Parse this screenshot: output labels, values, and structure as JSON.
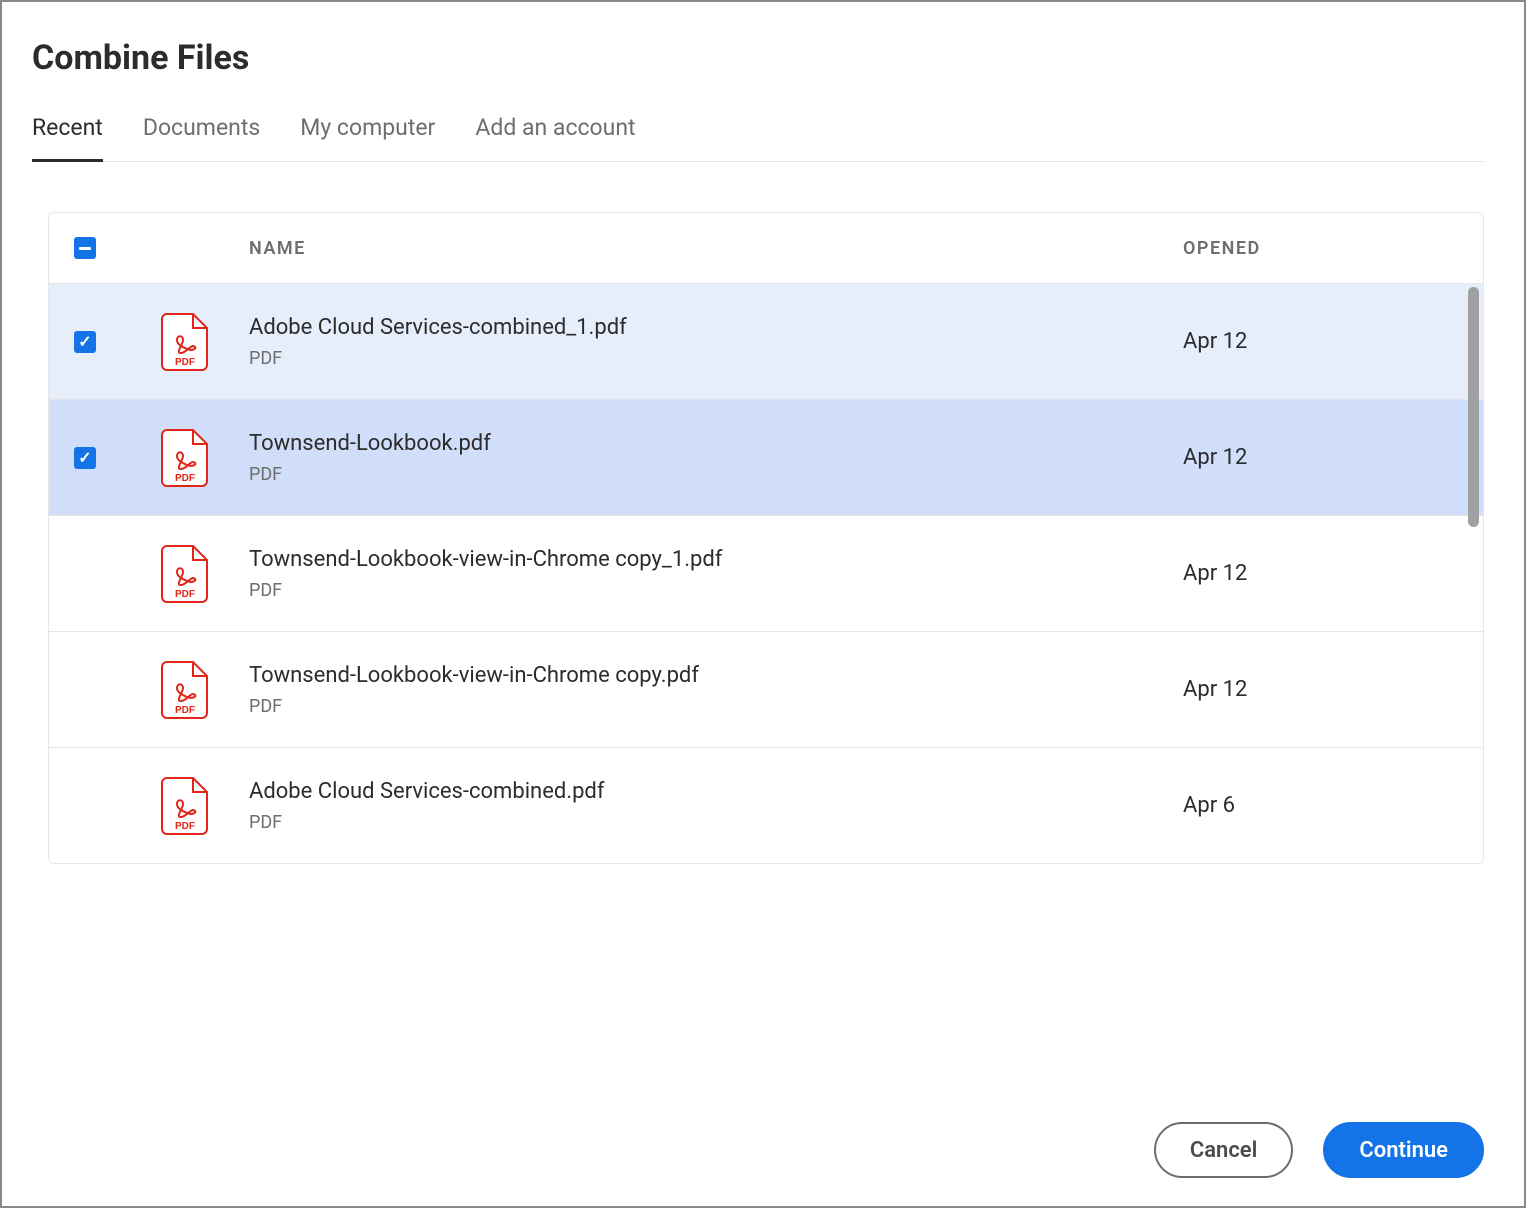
{
  "title": "Combine Files",
  "tabs": [
    {
      "label": "Recent",
      "active": true
    },
    {
      "label": "Documents",
      "active": false
    },
    {
      "label": "My computer",
      "active": false
    },
    {
      "label": "Add an account",
      "active": false
    }
  ],
  "headers": {
    "name": "NAME",
    "opened": "OPENED"
  },
  "files": [
    {
      "name": "Adobe Cloud Services-combined_1.pdf",
      "type": "PDF",
      "opened": "Apr 12",
      "selected": true,
      "hover": false
    },
    {
      "name": "Townsend-Lookbook.pdf",
      "type": "PDF",
      "opened": "Apr 12",
      "selected": true,
      "hover": true
    },
    {
      "name": "Townsend-Lookbook-view-in-Chrome copy_1.pdf",
      "type": "PDF",
      "opened": "Apr 12",
      "selected": false,
      "hover": false
    },
    {
      "name": "Townsend-Lookbook-view-in-Chrome copy.pdf",
      "type": "PDF",
      "opened": "Apr 12",
      "selected": false,
      "hover": false
    },
    {
      "name": "Adobe Cloud Services-combined.pdf",
      "type": "PDF",
      "opened": "Apr 6",
      "selected": false,
      "hover": false
    }
  ],
  "buttons": {
    "cancel": "Cancel",
    "continue": "Continue"
  }
}
